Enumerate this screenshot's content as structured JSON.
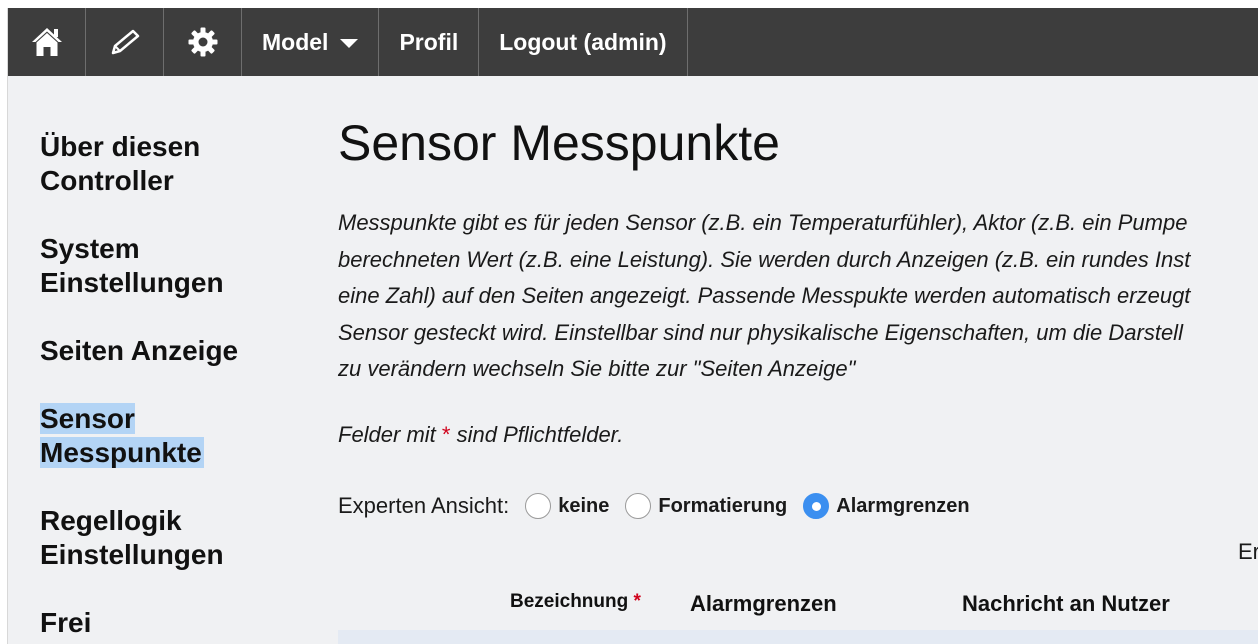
{
  "nav": {
    "home_icon": "home-icon",
    "edit_icon": "pencil-icon",
    "settings_icon": "gear-icon",
    "model_label": "Model",
    "profile_label": "Profil",
    "logout_label": "Logout (admin)"
  },
  "sidebar": {
    "items": [
      {
        "label": "Über diesen Controller"
      },
      {
        "label": "System Einstellungen"
      },
      {
        "label": "Seiten Anzeige"
      },
      {
        "label": "Sensor Messpunkte"
      },
      {
        "label": "Regellogik Einstellungen"
      },
      {
        "label": "Frei"
      }
    ]
  },
  "main": {
    "title": "Sensor Messpunkte",
    "description": "Messpunkte gibt es für jeden Sensor (z.B. ein Temperaturfühler), Aktor (z.B. ein Pumpe\nberechneten Wert (z.B. eine Leistung). Sie werden durch Anzeigen (z.B. ein rundes Inst\neine Zahl) auf den Seiten angezeigt. Passende Messpukte werden automatisch erzeugt\nSensor gesteckt wird. Einstellbar sind nur physikalische Eigenschaften, um die Darstell\nzu verändern wechseln Sie bitte zur \"Seiten Anzeige\"",
    "required_prefix": "Felder mit ",
    "required_star": "*",
    "required_suffix": " sind Pflichtfelder.",
    "expert_label": "Experten Ansicht:",
    "expert_options": [
      {
        "label": "keine",
        "checked": false
      },
      {
        "label": "Formatierung",
        "checked": false
      },
      {
        "label": "Alarmgrenzen",
        "checked": true
      }
    ],
    "er_text": "Er",
    "table_headers": {
      "bezeichnung": "Bezeichnung",
      "bezeichnung_star": "*",
      "alarmgrenzen": "Alarmgrenzen",
      "nachricht": "Nachricht an Nutzer"
    }
  },
  "colors": {
    "nav_bg": "#3d3d3d",
    "page_bg": "#f0f1f3",
    "selection_highlight": "#b3d4f5",
    "radio_checked": "#3b8ff0",
    "required_star": "#d0021b"
  }
}
